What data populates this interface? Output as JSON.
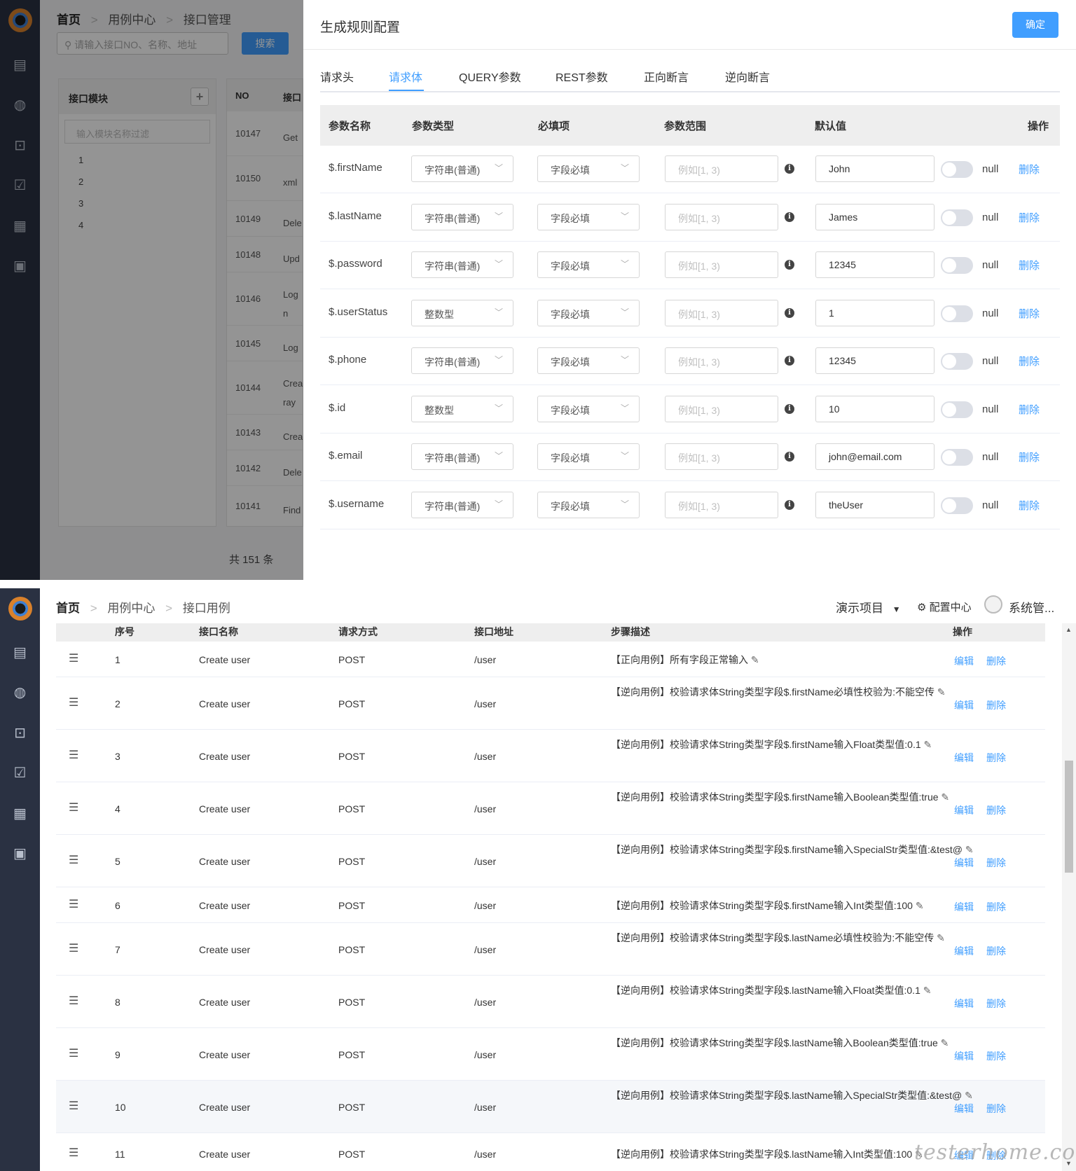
{
  "top": {
    "sidebar_icons": [
      "app-logo",
      "server-icon",
      "globe-icon",
      "lock-box-icon",
      "calendar-check-icon",
      "report-icon",
      "grid-icon"
    ],
    "breadcrumb": [
      "首页",
      "用例中心",
      "接口管理"
    ],
    "search_placeholder": "请输入接口NO、名称、地址",
    "search_button": "搜索",
    "module_panel": {
      "title": "接口模块",
      "filter_placeholder": "输入模块名称过滤",
      "items": [
        "1",
        "2",
        "3",
        "4"
      ]
    },
    "no_table": {
      "headers": [
        "NO",
        "接口"
      ],
      "rows": [
        {
          "no": "10147",
          "name": "Get"
        },
        {
          "no": "10150",
          "name": "xml"
        },
        {
          "no": "10149",
          "name": "Dele"
        },
        {
          "no": "10148",
          "name": "Upd"
        },
        {
          "no": "10146",
          "name": "Log\nn"
        },
        {
          "no": "10145",
          "name": "Log"
        },
        {
          "no": "10144",
          "name": "Crea\nray"
        },
        {
          "no": "10143",
          "name": "Crea"
        },
        {
          "no": "10142",
          "name": "Dele"
        },
        {
          "no": "10141",
          "name": "Find"
        }
      ],
      "total": "共 151 条"
    },
    "dialog": {
      "title": "生成规则配置",
      "confirm": "确定",
      "tabs": [
        "请求头",
        "请求体",
        "QUERY参数",
        "REST参数",
        "正向断言",
        "逆向断言"
      ],
      "active_tab": "请求体",
      "headers": [
        "参数名称",
        "参数类型",
        "必填项",
        "参数范围",
        "默认值",
        "操作"
      ],
      "range_placeholder": "例如[1, 3)",
      "null_label": "null",
      "delete_label": "删除",
      "rows": [
        {
          "name": "$.firstName",
          "type": "字符串(普通)",
          "required": "字段必填",
          "default": "John"
        },
        {
          "name": "$.lastName",
          "type": "字符串(普通)",
          "required": "字段必填",
          "default": "James"
        },
        {
          "name": "$.password",
          "type": "字符串(普通)",
          "required": "字段必填",
          "default": "12345"
        },
        {
          "name": "$.userStatus",
          "type": "整数型",
          "required": "字段必填",
          "default": "1"
        },
        {
          "name": "$.phone",
          "type": "字符串(普通)",
          "required": "字段必填",
          "default": "12345"
        },
        {
          "name": "$.id",
          "type": "整数型",
          "required": "字段必填",
          "default": "10"
        },
        {
          "name": "$.email",
          "type": "字符串(普通)",
          "required": "字段必填",
          "default": "john@email.com"
        },
        {
          "name": "$.username",
          "type": "字符串(普通)",
          "required": "字段必填",
          "default": "theUser"
        }
      ]
    }
  },
  "bottom": {
    "breadcrumb": [
      "首页",
      "用例中心",
      "接口用例"
    ],
    "project": "演示项目",
    "config_center": "配置中心",
    "user": "系统管...",
    "headers": [
      "序号",
      "接口名称",
      "请求方式",
      "接口地址",
      "步骤描述",
      "操作"
    ],
    "edit_label": "编辑",
    "delete_label": "删除",
    "rows": [
      {
        "idx": "1",
        "name": "Create user",
        "method": "POST",
        "path": "/user",
        "desc": "【正向用例】所有字段正常输入"
      },
      {
        "idx": "2",
        "name": "Create user",
        "method": "POST",
        "path": "/user",
        "desc": "【逆向用例】校验请求体String类型字段$.firstName必填性校验为:不能空传"
      },
      {
        "idx": "3",
        "name": "Create user",
        "method": "POST",
        "path": "/user",
        "desc": "【逆向用例】校验请求体String类型字段$.firstName输入Float类型值:0.1"
      },
      {
        "idx": "4",
        "name": "Create user",
        "method": "POST",
        "path": "/user",
        "desc": "【逆向用例】校验请求体String类型字段$.firstName输入Boolean类型值:true"
      },
      {
        "idx": "5",
        "name": "Create user",
        "method": "POST",
        "path": "/user",
        "desc": "【逆向用例】校验请求体String类型字段$.firstName输入SpecialStr类型值:&test@"
      },
      {
        "idx": "6",
        "name": "Create user",
        "method": "POST",
        "path": "/user",
        "desc": "【逆向用例】校验请求体String类型字段$.firstName输入Int类型值:100"
      },
      {
        "idx": "7",
        "name": "Create user",
        "method": "POST",
        "path": "/user",
        "desc": "【逆向用例】校验请求体String类型字段$.lastName必填性校验为:不能空传"
      },
      {
        "idx": "8",
        "name": "Create user",
        "method": "POST",
        "path": "/user",
        "desc": "【逆向用例】校验请求体String类型字段$.lastName输入Float类型值:0.1"
      },
      {
        "idx": "9",
        "name": "Create user",
        "method": "POST",
        "path": "/user",
        "desc": "【逆向用例】校验请求体String类型字段$.lastName输入Boolean类型值:true"
      },
      {
        "idx": "10",
        "name": "Create user",
        "method": "POST",
        "path": "/user",
        "desc": "【逆向用例】校验请求体String类型字段$.lastName输入SpecialStr类型值:&test@"
      },
      {
        "idx": "11",
        "name": "Create user",
        "method": "POST",
        "path": "/user",
        "desc": "【逆向用例】校验请求体String类型字段$.lastName输入Int类型值:100"
      }
    ],
    "highlighted_row": "10",
    "watermark": "testerhome.com"
  }
}
